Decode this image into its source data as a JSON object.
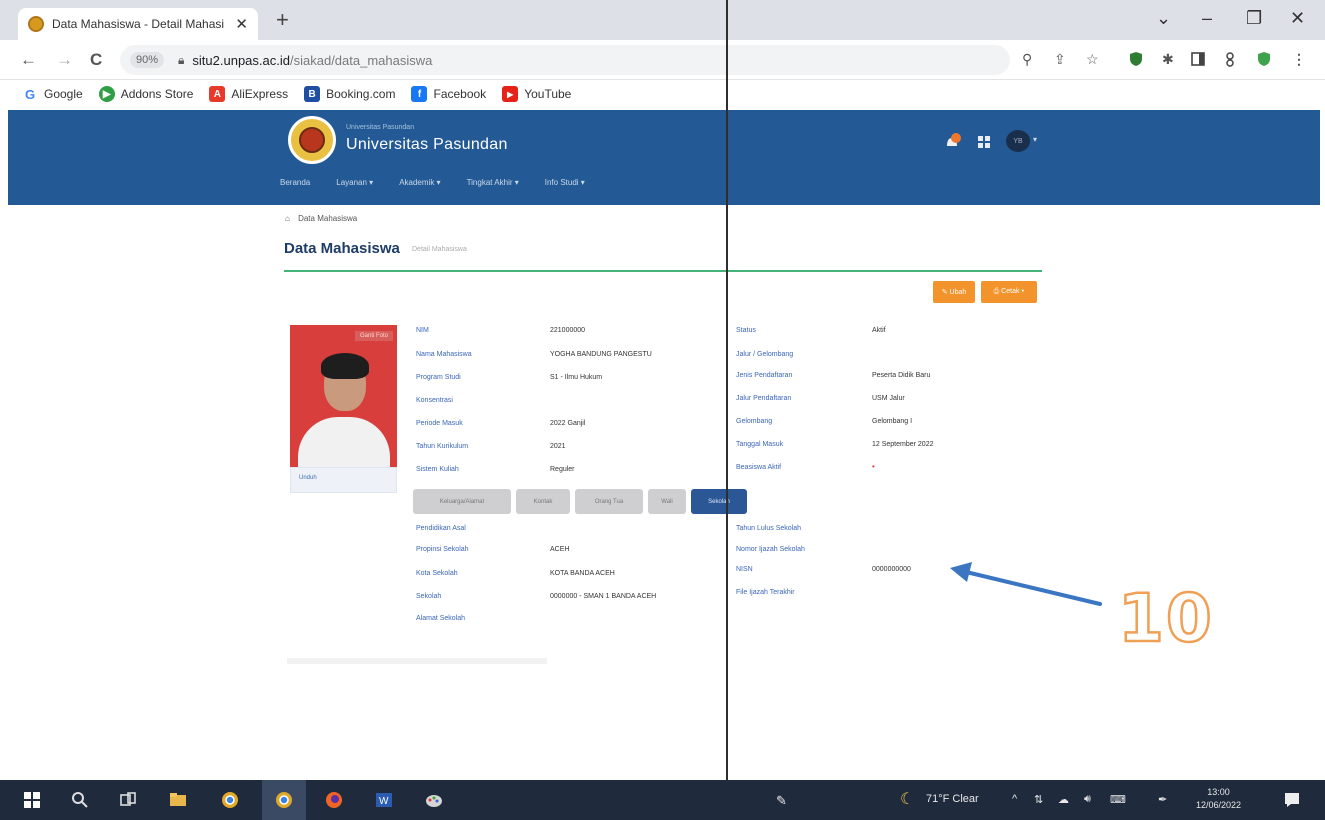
{
  "browser": {
    "tab_title": "Data Mahasiswa - Detail Mahasi",
    "tab_close": "✕",
    "new_tab": "+",
    "window_controls": [
      "⌄",
      "–",
      "❐",
      "✕"
    ],
    "nav": {
      "back": "←",
      "forward": "→",
      "reload": "C"
    },
    "zoom_badge": "90%",
    "url_host": "situ2.unpas.ac.id",
    "url_path": "/siakad/data_mahasiswa",
    "bookmarks": [
      {
        "label": "Google",
        "icon": "google-icon",
        "color": "#ffffff"
      },
      {
        "label": "Addons Store",
        "icon": "addons-icon",
        "color": "#2f9e44"
      },
      {
        "label": "AliExpress",
        "icon": "aliexpress-icon",
        "color": "#e8392b"
      },
      {
        "label": "Booking.com",
        "icon": "booking-icon",
        "color": "#1f4fa3"
      },
      {
        "label": "Facebook",
        "icon": "facebook-icon",
        "color": "#1877f2"
      },
      {
        "label": "YouTube",
        "icon": "youtube-icon",
        "color": "#e62117"
      }
    ]
  },
  "site": {
    "brand_small": "Universitas Pasundan",
    "brand_name": "Universitas Pasundan",
    "menu": [
      "Beranda",
      "Layanan ▾",
      "Akademik ▾",
      "Tingkat Akhir ▾",
      "Info Studi ▾"
    ],
    "avatar_initials": "YB",
    "colors": {
      "header": "#235a95",
      "accent": "#f3932b",
      "divider": "#45b27a",
      "label": "#3a66b8"
    }
  },
  "page": {
    "breadcrumb": "Data Mahasiswa",
    "title": "Data Mahasiswa",
    "subtitle": "Detail Mahasiswa",
    "btn_edit": "✎ Ubah",
    "btn_print": "⎙ Cetak ▾",
    "photo_tag": "Ganti Foto",
    "photo_caption": "Unduh"
  },
  "left_fields": [
    {
      "label": "NIM",
      "value": "221000000"
    },
    {
      "label": "Nama Mahasiswa",
      "value": "YOGHA BANDUNG PANGESTU"
    },
    {
      "label": "Program Studi",
      "value": "S1 - Ilmu Hukum"
    },
    {
      "label": "Konsentrasi",
      "value": ""
    },
    {
      "label": "Periode Masuk",
      "value": "2022 Ganjil"
    },
    {
      "label": "Tahun Kurikulum",
      "value": "2021"
    },
    {
      "label": "Sistem Kuliah",
      "value": "Reguler"
    }
  ],
  "right_fields": [
    {
      "label": "Status",
      "value": "Aktif"
    },
    {
      "label": "Jalur / Gelombang",
      "value": ""
    },
    {
      "label": "Jenis Pendaftaran",
      "value": "Peserta Didik Baru"
    },
    {
      "label": "Jalur Pendaftaran",
      "value": "USM Jalur"
    },
    {
      "label": "Gelombang",
      "value": "Gelombang I"
    },
    {
      "label": "Tanggal Masuk",
      "value": "12 September 2022"
    },
    {
      "label": "Beasiswa Aktif",
      "value": "•"
    }
  ],
  "tabs": [
    "Keluarga/Alamat",
    "Kontak",
    "Orang Tua",
    "Wali",
    "Sekolah"
  ],
  "school_left": [
    {
      "label": "Pendidikan Asal",
      "value": ""
    },
    {
      "label": "Propinsi Sekolah",
      "value": "ACEH"
    },
    {
      "label": "Kota Sekolah",
      "value": "KOTA BANDA ACEH"
    },
    {
      "label": "Sekolah",
      "value": "0000000 - SMAN 1 BANDA ACEH"
    },
    {
      "label": "Alamat Sekolah",
      "value": ""
    }
  ],
  "school_right": [
    {
      "label": "Tahun Lulus Sekolah",
      "value": ""
    },
    {
      "label": "Nomor Ijazah Sekolah",
      "value": ""
    },
    {
      "label": "NISN",
      "value": "0000000000"
    },
    {
      "label": "File Ijazah Terakhir",
      "value": ""
    }
  ],
  "annotation": {
    "label": "10",
    "color": "#f0a055",
    "arrow_color": "#3b76c2"
  },
  "taskbar": {
    "weather": "71°F Clear",
    "time": "13:00",
    "date": "12/06/2022"
  }
}
